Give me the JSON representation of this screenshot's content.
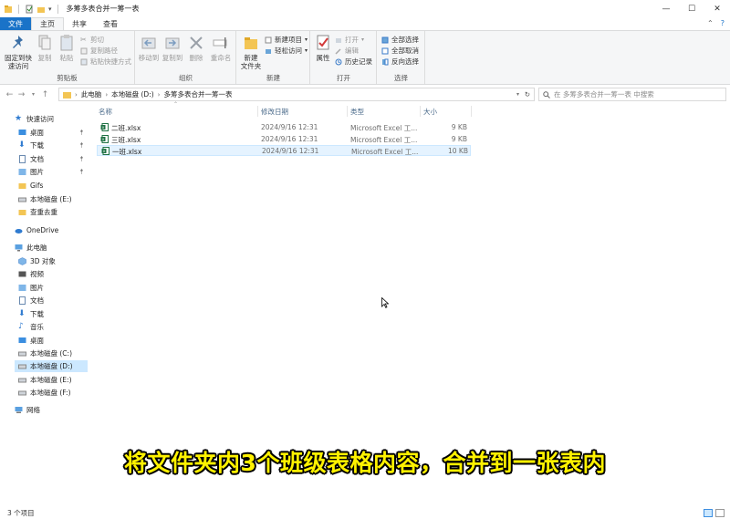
{
  "window": {
    "title": "多筹多表合并一筹一表",
    "controls": {
      "minimize": "—",
      "maximize": "☐",
      "close": "✕"
    }
  },
  "ribbon_tabs": [
    {
      "label": "文件"
    },
    {
      "label": "主页"
    },
    {
      "label": "共享"
    },
    {
      "label": "查看"
    }
  ],
  "ribbon": {
    "clipboard": {
      "label": "剪贴板",
      "pin_quick_access": [
        "固定到快",
        "速访问"
      ],
      "copy": "复制",
      "paste": "粘贴",
      "cut": "剪切",
      "copy_path": "复制路径",
      "paste_shortcut": "粘贴快捷方式"
    },
    "organize": {
      "label": "组织",
      "move_to": "移动到",
      "copy_to": "复制到",
      "delete": "删除",
      "rename": "重命名"
    },
    "new": {
      "label": "新建",
      "new_folder": [
        "新建",
        "文件夹"
      ],
      "new_item": "新建项目",
      "easy_access": "轻松访问"
    },
    "open": {
      "label": "打开",
      "properties": "属性",
      "open": "打开",
      "edit": "编辑",
      "history": "历史记录"
    },
    "select": {
      "label": "选择",
      "select_all": "全部选择",
      "select_none": "全部取消",
      "invert": "反向选择"
    }
  },
  "address": {
    "path": [
      "此电脑",
      "本地磁盘 (D:)",
      "多筹多表合并一筹一表"
    ],
    "search_placeholder": "在 多筹多表合并一筹一表 中搜索"
  },
  "nav": {
    "quick_access": "快速访问",
    "pinned": [
      "桌面",
      "下载",
      "文档",
      "图片"
    ],
    "recent": [
      "Gifs",
      "本地磁盘 (E:)",
      "查重去重"
    ],
    "onedrive": "OneDrive",
    "this_pc": "此电脑",
    "pc_items": [
      "3D 对象",
      "视频",
      "图片",
      "文档",
      "下载",
      "音乐",
      "桌面",
      "本地磁盘 (C:)",
      "本地磁盘 (D:)",
      "本地磁盘 (E:)",
      "本地磁盘 (F:)"
    ],
    "network": "网络"
  },
  "columns": {
    "name": "名称",
    "modified": "修改日期",
    "type": "类型",
    "size": "大小"
  },
  "files": [
    {
      "name": "二班.xlsx",
      "modified": "2024/9/16 12:31",
      "type": "Microsoft Excel 工...",
      "size": "9 KB"
    },
    {
      "name": "三班.xlsx",
      "modified": "2024/9/16 12:31",
      "type": "Microsoft Excel 工...",
      "size": "9 KB"
    },
    {
      "name": "一班.xlsx",
      "modified": "2024/9/16 12:31",
      "type": "Microsoft Excel 工...",
      "size": "10 KB"
    }
  ],
  "status": {
    "count": "3 个项目"
  },
  "caption": "将文件夹内3个班级表格内容，合并到一张表内",
  "colors": {
    "accent": "#1a73c8",
    "selection": "#cce8ff",
    "caption": "#fff200",
    "folder": "#f3c554",
    "excel": "#1f7244"
  }
}
